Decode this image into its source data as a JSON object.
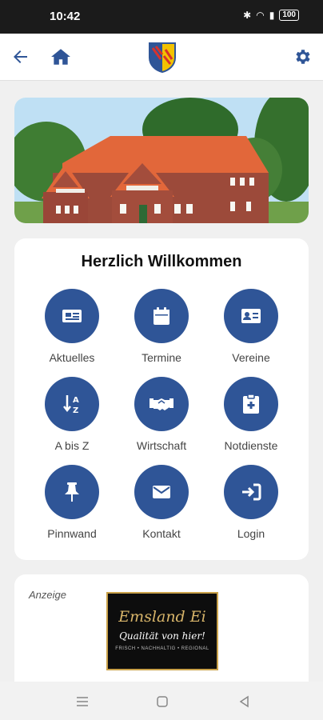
{
  "status": {
    "time": "10:42",
    "battery": "100"
  },
  "appbar": {
    "back_icon": "arrow-left-icon",
    "home_icon": "home-icon",
    "settings_icon": "gear-icon",
    "accent": "#2f5597"
  },
  "welcome": {
    "title": "Herzlich Willkommen",
    "tiles": [
      {
        "label": "Aktuelles",
        "icon": "newspaper-icon"
      },
      {
        "label": "Termine",
        "icon": "calendar-icon"
      },
      {
        "label": "Vereine",
        "icon": "id-card-icon"
      },
      {
        "label": "A bis Z",
        "icon": "sort-az-icon"
      },
      {
        "label": "Wirtschaft",
        "icon": "handshake-icon"
      },
      {
        "label": "Notdienste",
        "icon": "clipboard-medical-icon"
      },
      {
        "label": "Pinnwand",
        "icon": "pin-icon"
      },
      {
        "label": "Kontakt",
        "icon": "envelope-icon"
      },
      {
        "label": "Login",
        "icon": "sign-in-icon"
      }
    ]
  },
  "ad": {
    "tag": "Anzeige",
    "brand": "Emsland Ei",
    "slogan": "Qualität von hier!",
    "small": "FRISCH • NACHHALTIG • REGIONAL"
  }
}
